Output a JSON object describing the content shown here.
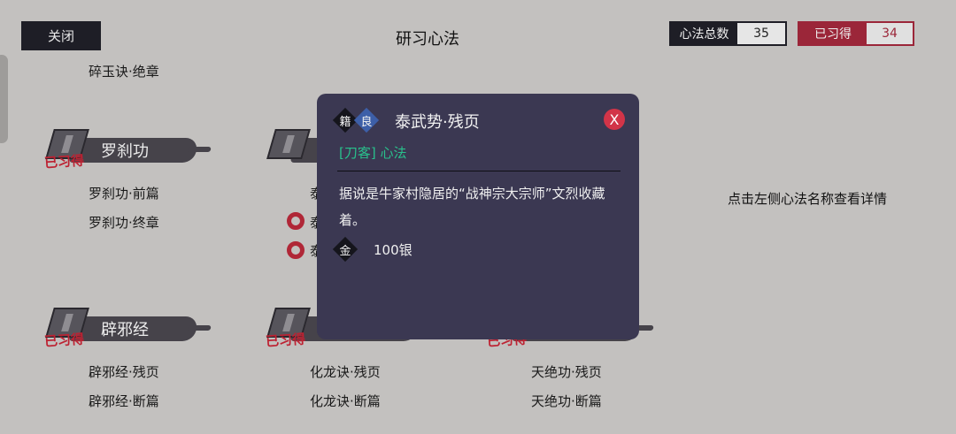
{
  "header": {
    "close_label": "关闭",
    "title": "研习心法",
    "total": {
      "label": "心法总数",
      "value": "35"
    },
    "owned": {
      "label": "已习得",
      "value": "34"
    }
  },
  "list": {
    "top_entry": "碎玉诀·绝章",
    "groups": [
      {
        "name": "罗刹功",
        "stamp": "已习得",
        "entries": [
          "罗刹功·前篇",
          "罗刹功·终章"
        ]
      },
      {
        "name": "",
        "stamp": "",
        "entries": [
          "泰",
          "泰",
          "泰"
        ]
      },
      {
        "name": "辟邪经",
        "stamp": "已习得",
        "entries": [
          "辟邪经·残页",
          "辟邪经·断篇"
        ]
      },
      {
        "name": "",
        "stamp": "已习得",
        "entries": [
          "化龙诀·残页",
          "化龙诀·断篇"
        ]
      },
      {
        "name": "",
        "stamp": "已习得",
        "entries": [
          "天绝功·残页",
          "天绝功·断篇"
        ]
      }
    ]
  },
  "hint": "点击左侧心法名称查看详情",
  "modal": {
    "type_tag": "籍",
    "quality_tag": "良",
    "item_name": "泰武势·残页",
    "close_label": "X",
    "category": "[刀客] 心法",
    "description": "据说是牛家村隐居的“战神宗大宗师”文烈收藏着。",
    "price_tag": "金",
    "price": "100银",
    "colors": {
      "bg": "#3b3852",
      "category": "#29c08c",
      "quality": "#3d5fa8",
      "close": "#d23448"
    }
  }
}
